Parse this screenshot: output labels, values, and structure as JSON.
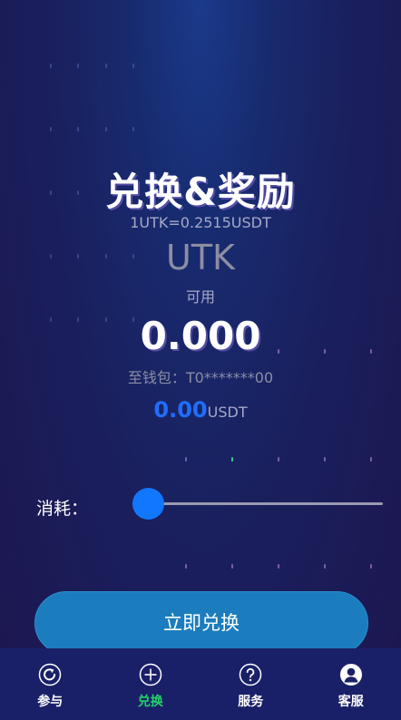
{
  "header": {
    "title": "兑换&奖励",
    "rate": "1UTK=0.2515USDT"
  },
  "token": {
    "symbol": "UTK",
    "available_label": "可用",
    "balance": "0.000"
  },
  "wallet": {
    "text": "至钱包：T0*******00"
  },
  "conversion": {
    "amount": "0.00",
    "unit": "USDT"
  },
  "slider": {
    "label": "消耗：",
    "value": 0
  },
  "action": {
    "exchange_label": "立即兑换"
  },
  "tabbar": {
    "items": [
      {
        "label": "参与",
        "icon": "refresh-icon"
      },
      {
        "label": "兑换",
        "icon": "plus-circle-icon"
      },
      {
        "label": "服务",
        "icon": "help-icon"
      },
      {
        "label": "客服",
        "icon": "user-icon"
      }
    ],
    "active_index": 1
  },
  "colors": {
    "accent": "#1277ff",
    "active_tab": "#22d36b",
    "button": "#1b7dbd"
  }
}
